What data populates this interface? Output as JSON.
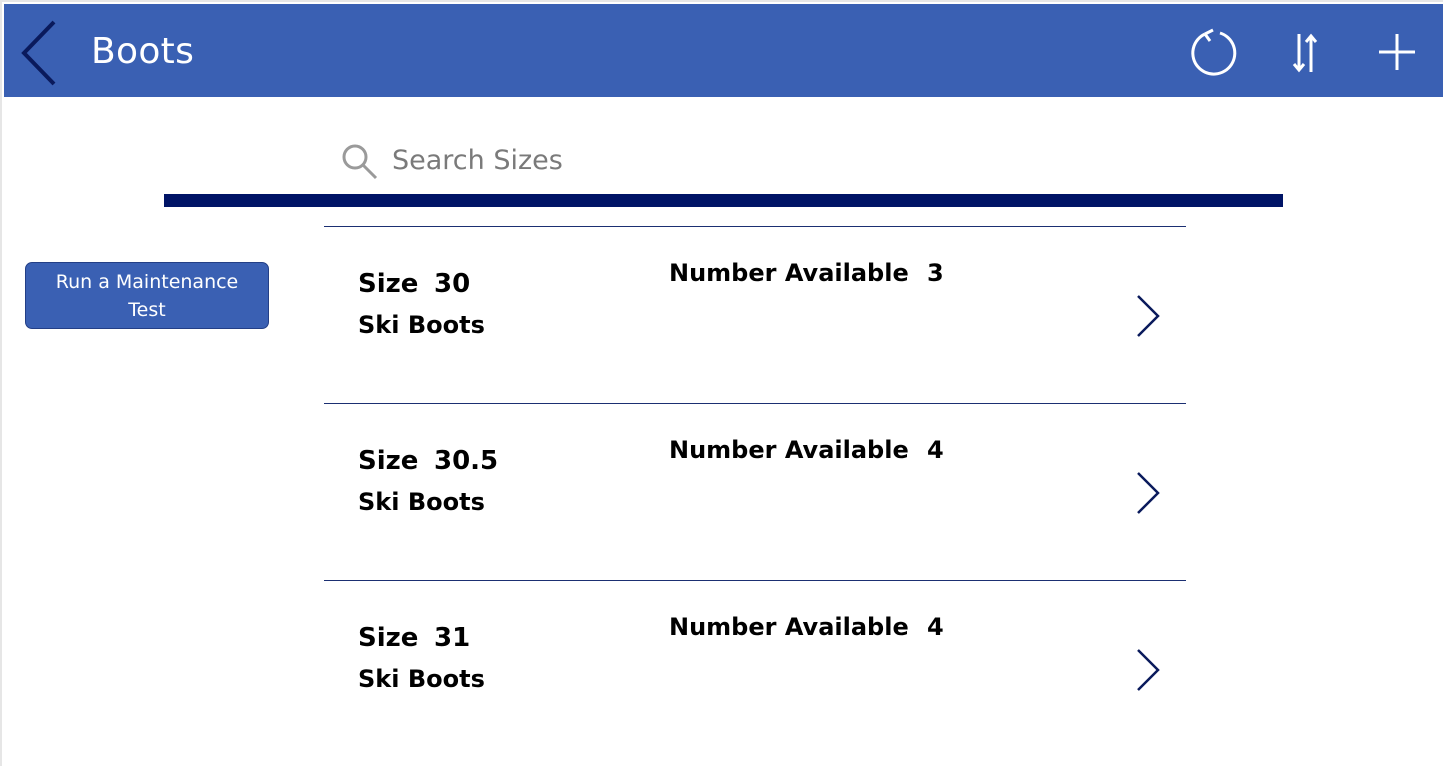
{
  "header": {
    "title": "Boots",
    "color": "#3a60b3",
    "icons": [
      "back-icon",
      "refresh-icon",
      "sort-icon",
      "add-icon"
    ]
  },
  "search": {
    "value": "",
    "placeholder": "Search Sizes",
    "underline_color": "#001466"
  },
  "maintenance_button": {
    "label": "Run a Maintenance Test"
  },
  "gallery": {
    "size_label": "Size",
    "available_label": "Number Available",
    "items": [
      {
        "size": "30",
        "type": "Ski Boots",
        "available": "3"
      },
      {
        "size": "30.5",
        "type": "Ski Boots",
        "available": "4"
      },
      {
        "size": "31",
        "type": "Ski Boots",
        "available": "4"
      }
    ]
  }
}
